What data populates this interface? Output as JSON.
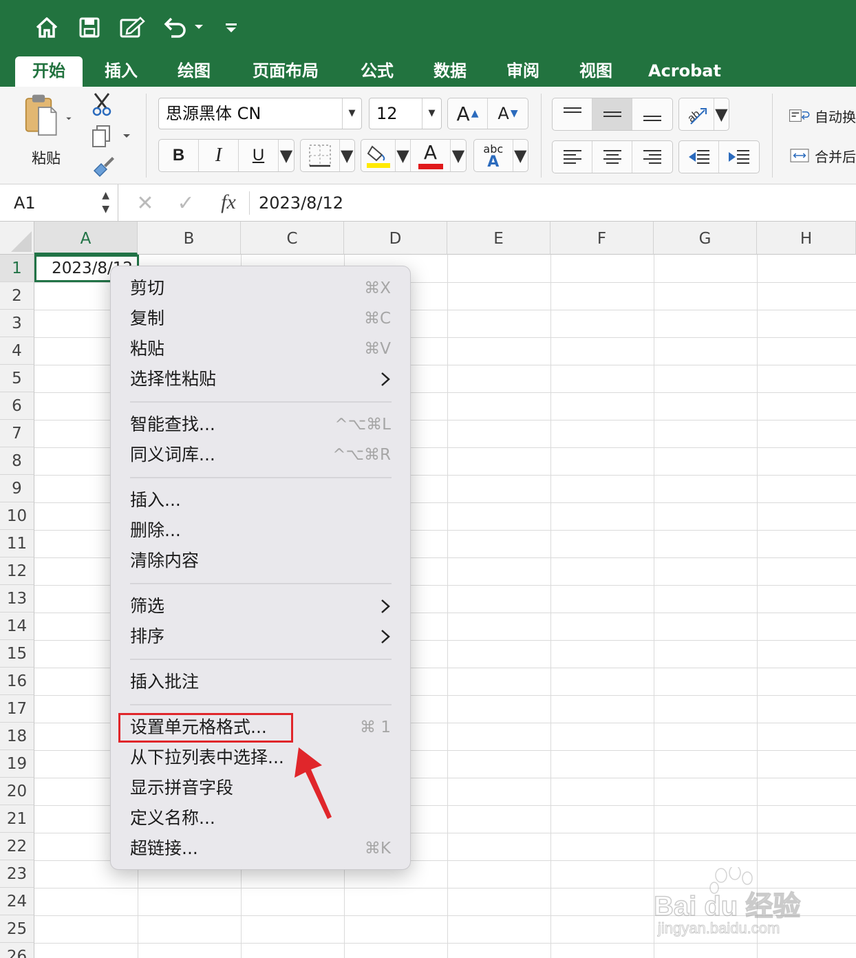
{
  "quick_access": {
    "icons": [
      "home-icon",
      "save-icon",
      "edit-icon",
      "undo-icon",
      "customize-icon"
    ]
  },
  "tabs": [
    {
      "label": "开始",
      "active": true
    },
    {
      "label": "插入",
      "active": false
    },
    {
      "label": "绘图",
      "active": false
    },
    {
      "label": "页面布局",
      "active": false
    },
    {
      "label": "公式",
      "active": false
    },
    {
      "label": "数据",
      "active": false
    },
    {
      "label": "审阅",
      "active": false
    },
    {
      "label": "视图",
      "active": false
    },
    {
      "label": "Acrobat",
      "active": false
    }
  ],
  "ribbon": {
    "paste_label": "粘贴",
    "font_name": "思源黑体 CN",
    "font_size": "12",
    "bold": "B",
    "italic": "I",
    "underline": "U",
    "grow_font": "A",
    "shrink_font": "A",
    "font_color_letter": "A",
    "abc_label": "abc",
    "abc_letter": "A",
    "wrap_text": "自动换",
    "merge_center": "合并后",
    "colors": {
      "highlight": "#ffea00",
      "font_color": "#e0191b",
      "accent": "#217346",
      "title_green": "#22733f"
    }
  },
  "formula_bar": {
    "name_box": "A1",
    "fx": "fx",
    "value": "2023/8/12"
  },
  "sheet": {
    "columns": [
      "A",
      "B",
      "C",
      "D",
      "E",
      "F",
      "G",
      "H"
    ],
    "rows": [
      "1",
      "2",
      "3",
      "4",
      "5",
      "6",
      "7",
      "8",
      "9",
      "10",
      "11",
      "12",
      "13",
      "14",
      "15",
      "16",
      "17",
      "18",
      "19",
      "20",
      "21",
      "22",
      "23",
      "24",
      "25",
      "26"
    ],
    "selected_cell": "A1",
    "a1_value": "2023/8/12"
  },
  "context_menu": {
    "items": [
      {
        "label": "剪切",
        "shortcut": "⌘X"
      },
      {
        "label": "复制",
        "shortcut": "⌘C"
      },
      {
        "label": "粘贴",
        "shortcut": "⌘V"
      },
      {
        "label": "选择性粘贴",
        "submenu": true
      },
      {
        "label": "智能查找...",
        "shortcut": "^⌥⌘L"
      },
      {
        "label": "同义词库...",
        "shortcut": "^⌥⌘R"
      },
      {
        "label": "插入..."
      },
      {
        "label": "删除..."
      },
      {
        "label": "清除内容"
      },
      {
        "label": "筛选",
        "submenu": true
      },
      {
        "label": "排序",
        "submenu": true
      },
      {
        "label": "插入批注"
      },
      {
        "label": "设置单元格格式...",
        "shortcut": "⌘ 1",
        "highlighted": true
      },
      {
        "label": "从下拉列表中选择..."
      },
      {
        "label": "显示拼音字段"
      },
      {
        "label": "定义名称..."
      },
      {
        "label": "超链接...",
        "shortcut": "⌘K"
      }
    ]
  },
  "watermark": {
    "brand": "Bai du 经验",
    "url": "jingyan.baidu.com"
  }
}
